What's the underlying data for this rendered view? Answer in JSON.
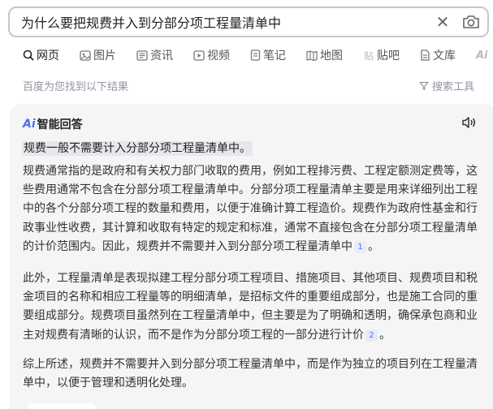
{
  "search": {
    "query": "为什么要把规费并入到分部分项工程量清单中"
  },
  "tabs": [
    {
      "label": "网页",
      "icon": "search-icon"
    },
    {
      "label": "图片",
      "icon": "image-icon"
    },
    {
      "label": "资讯",
      "icon": "news-icon"
    },
    {
      "label": "视频",
      "icon": "video-icon"
    },
    {
      "label": "笔记",
      "icon": "note-icon"
    },
    {
      "label": "地图",
      "icon": "map-icon"
    },
    {
      "label": "贴吧",
      "icon": "tieba-icon"
    },
    {
      "label": "文库",
      "icon": "wenku-icon"
    }
  ],
  "results": {
    "hint": "百度为您找到以下结果",
    "tools_label": "搜索工具"
  },
  "ai_answer": {
    "logo": "Ai",
    "title": "智能回答",
    "summary": "规费一般不需要计入分部分项工程量清单中。",
    "paragraphs": [
      {
        "text": "规费通常指的是政府和有关权力部门收取的费用，例如工程排污费、工程定额测定费等，这些费用通常不包含在分部分项工程量清单中。分部分项工程量清单主要是用来详细列出工程中的各个分部分项工程的数量和费用，以便于准确计算工程造价。规费作为政府性基金和行政事业性收费，其计算和收取有特定的规定和标准，通常不直接包含在分部分项工程量清单的计价范围内。因此，规费并不需要并入到分部分项工程量清单中",
        "ref": "1",
        "tail": "。"
      },
      {
        "text": "此外，工程量清单是表现拟建工程分部分项工程项目、措施项目、其他项目、规费项目和税金项目的名称和相应工程量等的明细清单，是招标文件的重要组成部分，也是施工合同的重要组成部分。规费项目虽然列在工程量清单中，但主要是为了明确和透明，确保承包商和业主对规费有清晰的认识，而不是作为分部分项工程的一部分进行计价",
        "ref": "2",
        "tail": "。"
      },
      {
        "text": "综上所述，规费并不需要并入到分部分项工程量清单中，而是作为独立的项目列在工程量清单中，以便于管理和透明化处理。",
        "ref": "",
        "tail": ""
      }
    ]
  },
  "colors": {
    "accent": "#4e6ef2",
    "card_bg": "#f5f5f6",
    "muted": "#9195a3"
  }
}
